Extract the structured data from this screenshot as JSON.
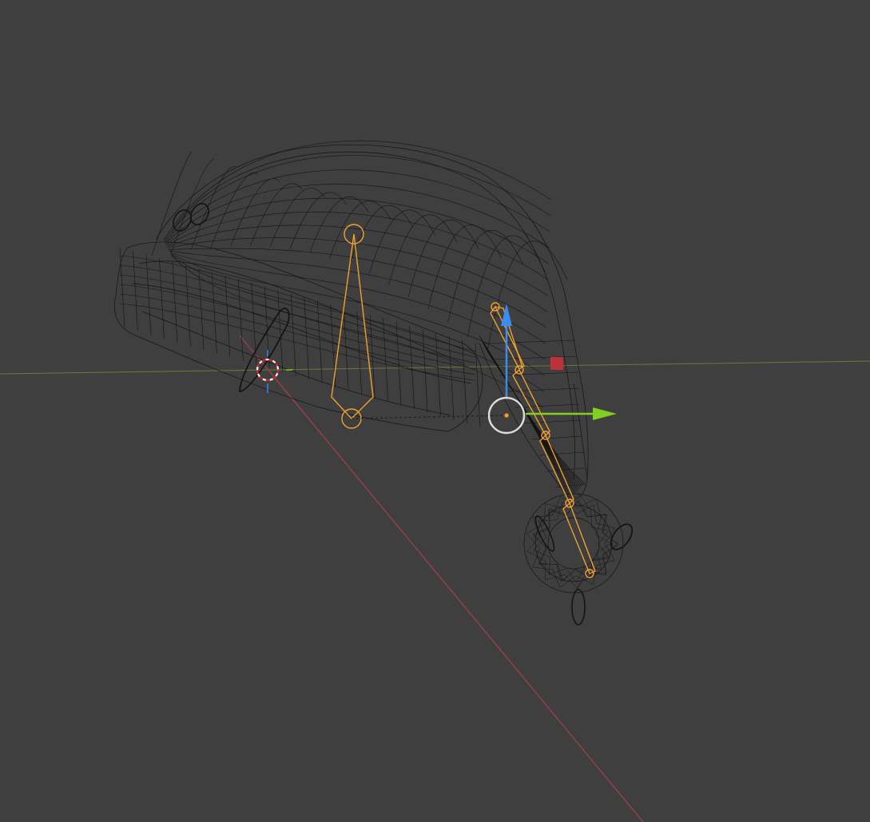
{
  "viewport": {
    "mode": "wireframe",
    "background": "#3f3f3f"
  },
  "colors": {
    "mesh": "#141414",
    "bones": "#f0a030",
    "axis_x": "#a0404a",
    "axis_y_floor": "#6a7a3a",
    "gizmo_z": "#3a8cf0",
    "gizmo_y": "#80d020",
    "gizmo_x": "#c03038",
    "gizmo_ring": "#dcdcdc",
    "cursor_red": "#e02020",
    "cursor_white": "#ffffff"
  },
  "objects": {
    "mesh": "santa-hat-mesh",
    "armature": "hat-armature",
    "bone_count": 5
  },
  "icons": {
    "gizmo": "transform-gizmo-icon",
    "cursor": "3d-cursor-icon"
  }
}
